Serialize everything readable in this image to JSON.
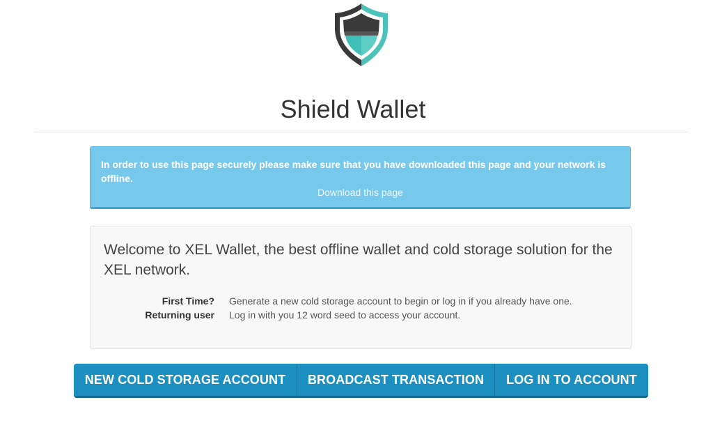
{
  "header": {
    "logo_icon": "shield-logo-icon",
    "title": "Shield Wallet"
  },
  "alert": {
    "message": "In order to use this page securely please make sure that you have downloaded this page and your network is offline.",
    "link": "Download this page"
  },
  "welcome": {
    "heading": "Welcome to XEL Wallet, the best offline wallet and cold storage solution for the XEL network.",
    "items": [
      {
        "term": "First Time?",
        "description": "Generate a new cold storage account to begin or log in if you already have one."
      },
      {
        "term": "Returning user",
        "description": "Log in with you 12 word seed to access your account."
      }
    ]
  },
  "actions": {
    "new_account": "NEW COLD STORAGE ACCOUNT",
    "broadcast": "BROADCAST TRANSACTION",
    "login": "LOG IN TO ACCOUNT"
  },
  "colors": {
    "accent": "#1a8fc0",
    "alert_bg": "#77c9eb",
    "shield_teal": "#3fbfb5",
    "shield_dark": "#3a3a3a"
  }
}
